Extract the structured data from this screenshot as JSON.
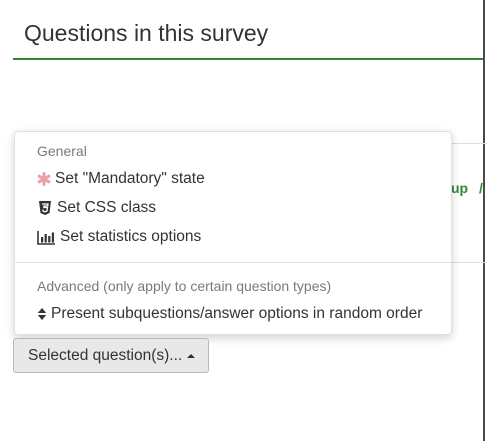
{
  "page": {
    "title": "Questions in this survey"
  },
  "background": {
    "group_link_text": "up",
    "group_separator": "/"
  },
  "menu": {
    "general_header": "General",
    "items_general": [
      {
        "label": "Set \"Mandatory\" state",
        "icon": "asterisk-icon"
      },
      {
        "label": "Set CSS class",
        "icon": "css3-icon"
      },
      {
        "label": "Set statistics options",
        "icon": "bar-chart-icon"
      }
    ],
    "advanced_header": "Advanced (only apply to certain question types)",
    "items_advanced": [
      {
        "label": "Present subquestions/answer options in random order",
        "icon": "sort-icon"
      }
    ]
  },
  "button": {
    "label": "Selected question(s)...",
    "icon": "caret-up-icon"
  },
  "colors": {
    "accent_green": "#328637",
    "asterisk_pink": "#e8a0a4",
    "button_bg": "#e8e8e8"
  }
}
